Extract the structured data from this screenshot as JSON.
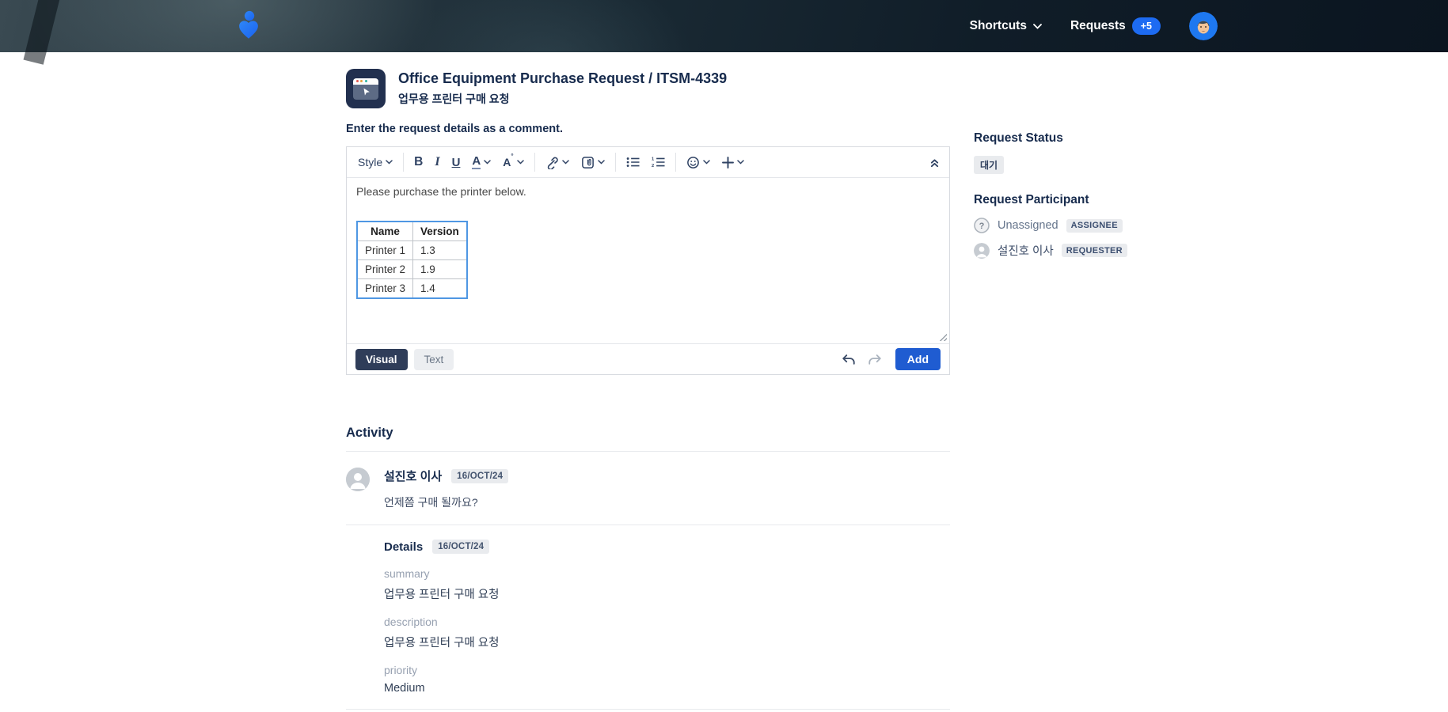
{
  "navbar": {
    "shortcuts_label": "Shortcuts",
    "requests_label": "Requests",
    "requests_badge": "+5"
  },
  "request": {
    "title": "Office Equipment Purchase Request / ITSM-4339",
    "subtitle": "업무용 프린터 구매 요청",
    "comment_prompt": "Enter the request details as a comment."
  },
  "editor": {
    "style_label": "Style",
    "bold_label": "B",
    "italic_label": "I",
    "underline_label": "U",
    "textcolor_label": "A",
    "textstyle_label": "A",
    "content_text": "Please purchase the printer below.",
    "table": {
      "headers": [
        "Name",
        "Version"
      ],
      "rows": [
        [
          "Printer 1",
          "1.3"
        ],
        [
          "Printer 2",
          "1.9"
        ],
        [
          "Printer 3",
          "1.4"
        ]
      ]
    },
    "visual_tab": "Visual",
    "text_tab": "Text",
    "add_button": "Add"
  },
  "sidebar": {
    "status_heading": "Request Status",
    "status_value": "대기",
    "participant_heading": "Request Participant",
    "participants": [
      {
        "name": "Unassigned",
        "role": "ASSIGNEE"
      },
      {
        "name": "설진호 이사",
        "role": "REQUESTER"
      }
    ]
  },
  "activity": {
    "heading": "Activity",
    "comment": {
      "author": "설진호 이사",
      "date": "16/OCT/24",
      "text": "언제쯤 구매 될까요?"
    },
    "details": {
      "heading": "Details",
      "date": "16/OCT/24",
      "fields": [
        {
          "label": "summary",
          "value": "업무용 프린터 구매 요청"
        },
        {
          "label": "description",
          "value": "업무용 프린터 구매 요청"
        },
        {
          "label": "priority",
          "value": "Medium"
        }
      ]
    }
  },
  "colors": {
    "accent_blue": "#1f5cd1",
    "navy_text": "#172b4d",
    "badge_bg": "#e9ebee",
    "table_selection_border": "#4f97e3"
  }
}
